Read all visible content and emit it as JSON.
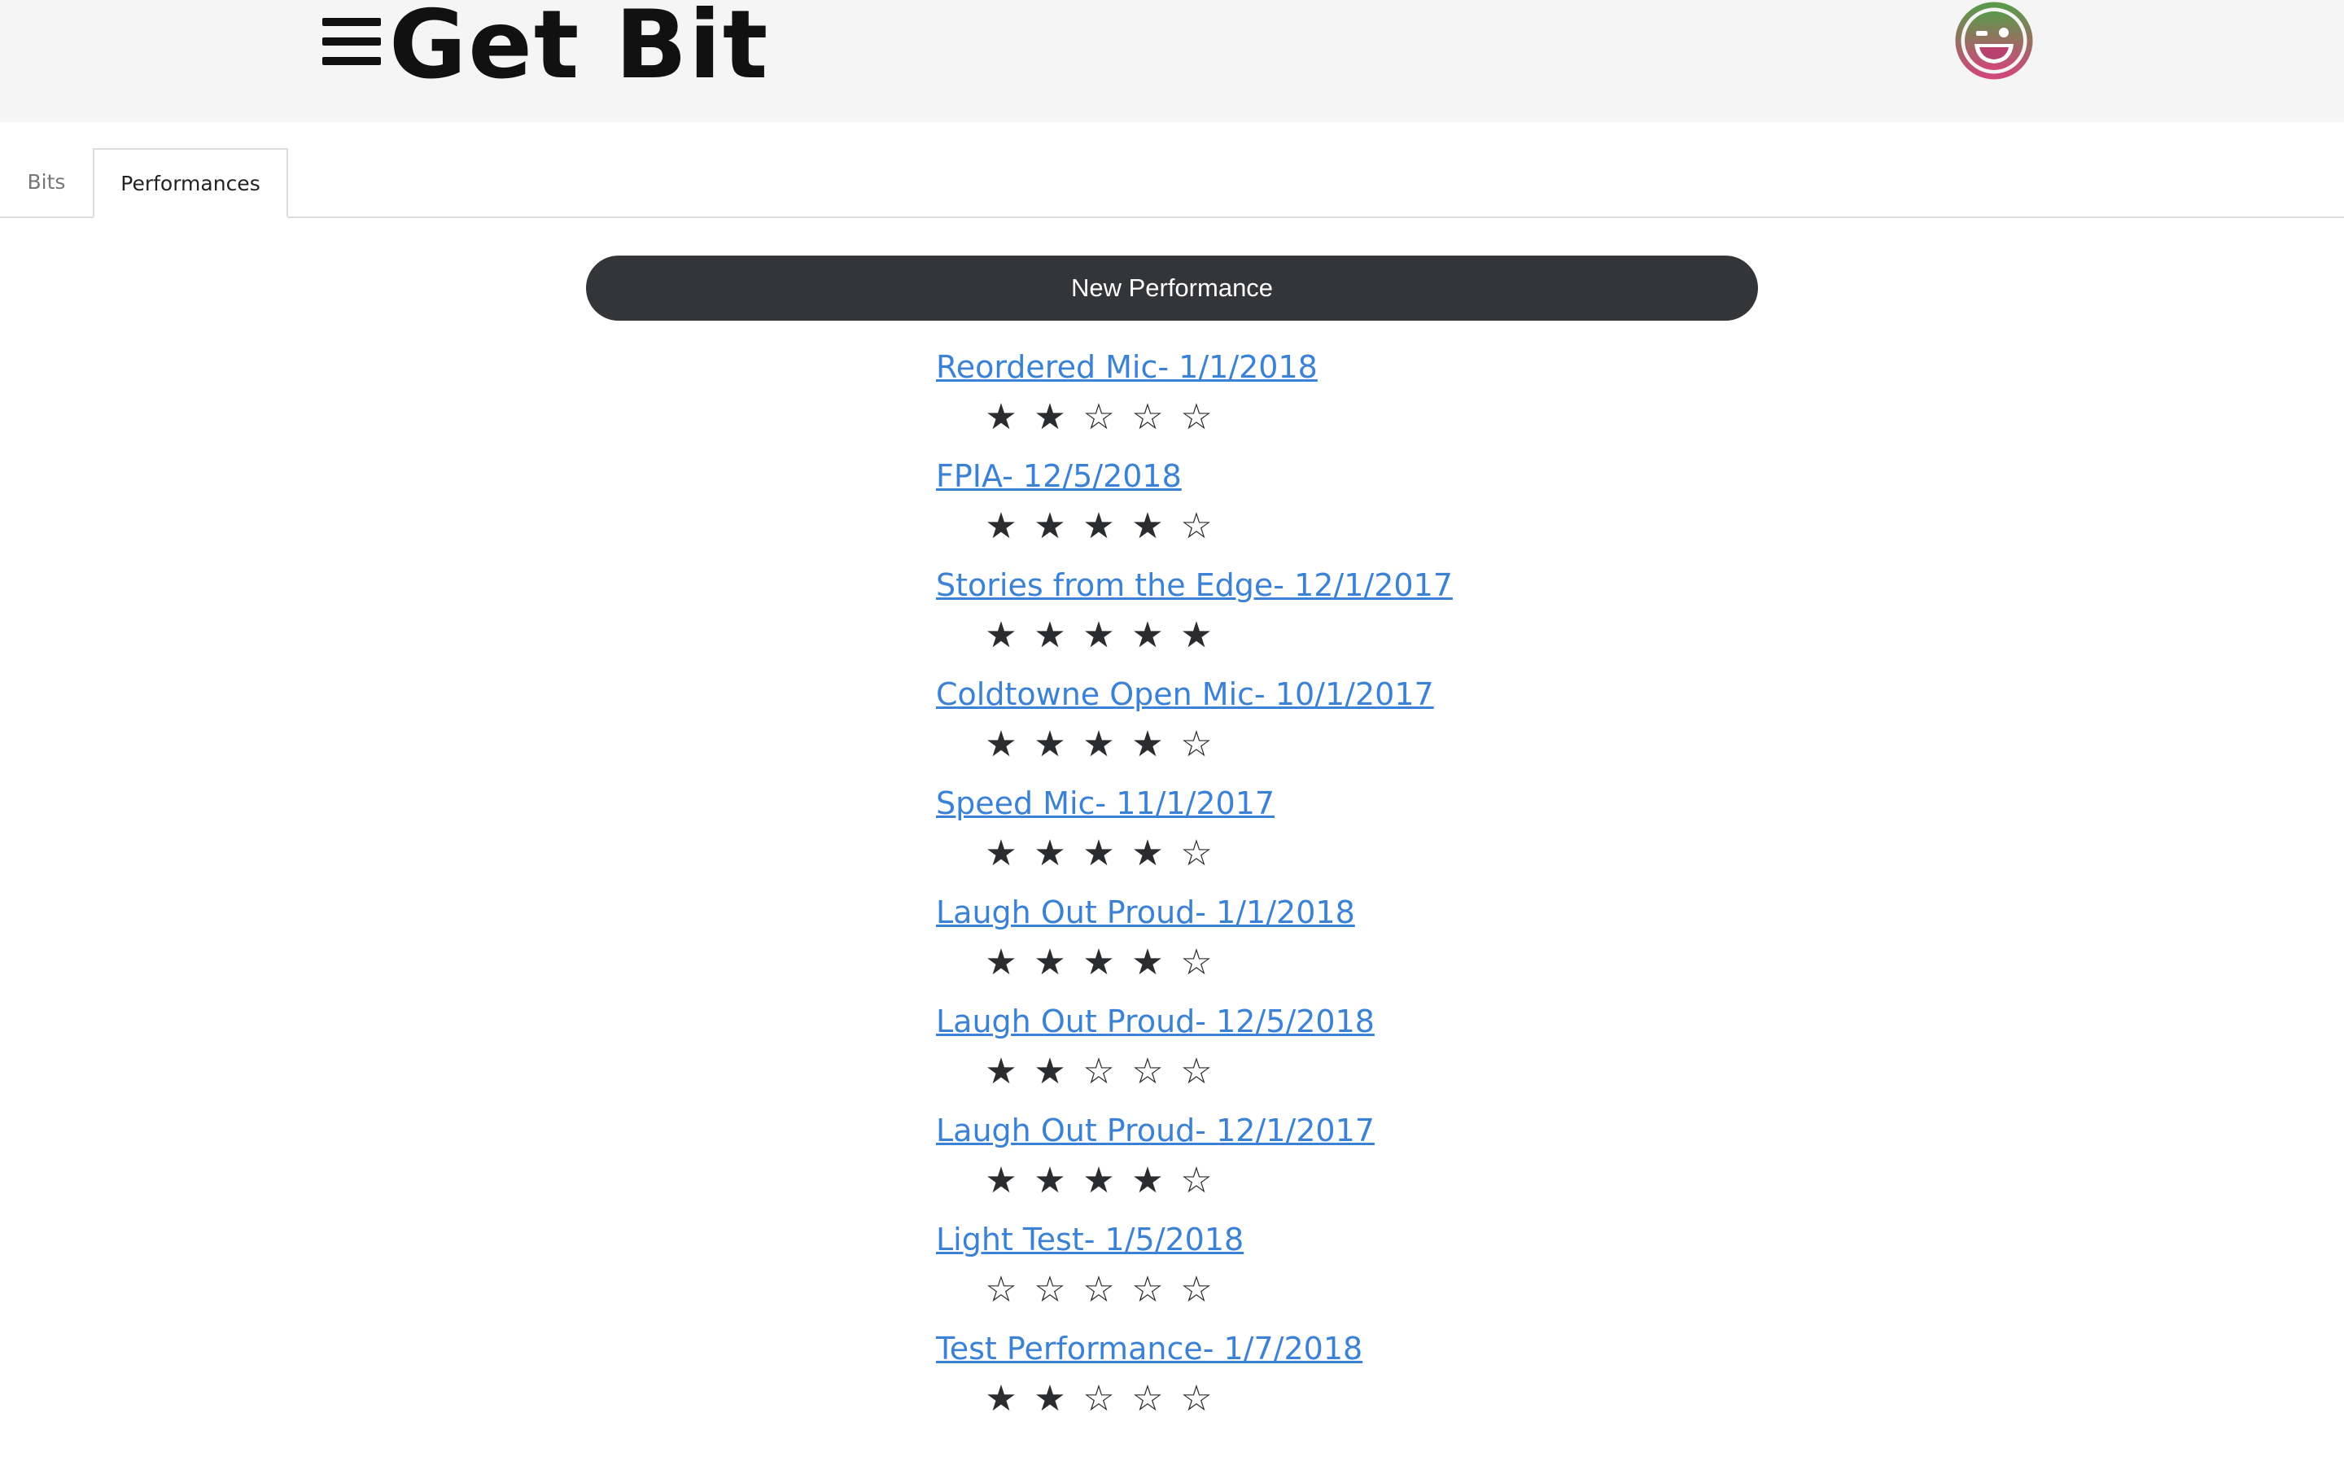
{
  "header": {
    "brand": "Get Bit",
    "menu_icon": "hamburger-menu-icon",
    "avatar_icon": "winking-face-icon",
    "avatar_colors": {
      "top": "#5a9a4a",
      "bottom": "#d0477a"
    }
  },
  "tabs": [
    {
      "label": "Bits",
      "active": false
    },
    {
      "label": "Performances",
      "active": true
    }
  ],
  "actions": {
    "new_performance_label": "New Performance"
  },
  "colors": {
    "link": "#3b82d6",
    "button_bg": "#343539",
    "star": "#2b2c30"
  },
  "rating_max": 5,
  "performances": [
    {
      "title": "Reordered Mic- 1/1/2018",
      "rating": 2
    },
    {
      "title": "FPIA- 12/5/2018",
      "rating": 4
    },
    {
      "title": "Stories from the Edge- 12/1/2017",
      "rating": 5
    },
    {
      "title": "Coldtowne Open Mic- 10/1/2017",
      "rating": 4
    },
    {
      "title": "Speed Mic- 11/1/2017",
      "rating": 4
    },
    {
      "title": "Laugh Out Proud- 1/1/2018",
      "rating": 4
    },
    {
      "title": "Laugh Out Proud- 12/5/2018",
      "rating": 2
    },
    {
      "title": "Laugh Out Proud- 12/1/2017",
      "rating": 4
    },
    {
      "title": "Light Test- 1/5/2018",
      "rating": 0
    },
    {
      "title": "Test Performance- 1/7/2018",
      "rating": 2
    }
  ]
}
